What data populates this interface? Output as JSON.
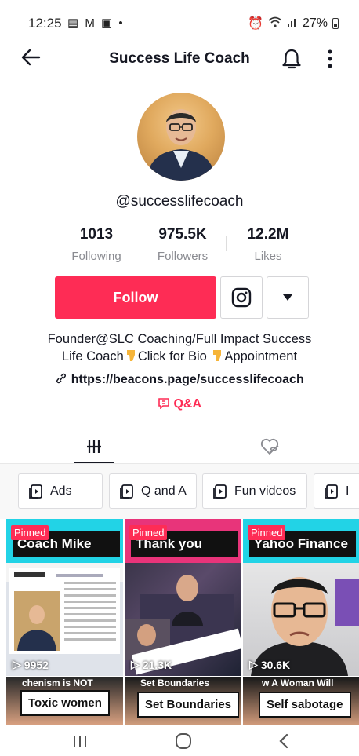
{
  "status_bar": {
    "time": "12:25",
    "left_icons": "▤ M ▣ •",
    "battery": "27%"
  },
  "header": {
    "title": "Success Life Coach"
  },
  "profile": {
    "username": "@successlifecoach",
    "stats": [
      {
        "value": "1013",
        "label": "Following"
      },
      {
        "value": "975.5K",
        "label": "Followers"
      },
      {
        "value": "12.2M",
        "label": "Likes"
      }
    ],
    "follow_label": "Follow",
    "bio_line1": "Founder@SLC Coaching/Full Impact Success",
    "bio_line2a": "Life Coach",
    "bio_line2b": "Click for Bio ",
    "bio_line2c": "Appointment",
    "link": "https://beacons.page/successlifecoach",
    "qa_label": "Q&A"
  },
  "playlists": [
    {
      "label": "Ads"
    },
    {
      "label": "Q and A"
    },
    {
      "label": "Fun videos"
    },
    {
      "label": "I"
    }
  ],
  "videos": [
    {
      "pinned": "Pinned",
      "caption": "Coach Mike",
      "views": "9952"
    },
    {
      "pinned": "Pinned",
      "caption": "Thank you",
      "views": "21.3K"
    },
    {
      "pinned": "Pinned",
      "caption": "Yahoo Finance",
      "views": "30.6K"
    },
    {
      "caption": "Toxic women",
      "top_text": "chenism is  NOT"
    },
    {
      "caption": "Set Boundaries",
      "top_text": "Set Boundaries"
    },
    {
      "caption": "Self sabotage",
      "top_text": "w A Woman Will"
    }
  ],
  "colors": {
    "accent": "#fe2c55",
    "text": "#161823",
    "muted": "#8a8b91"
  }
}
